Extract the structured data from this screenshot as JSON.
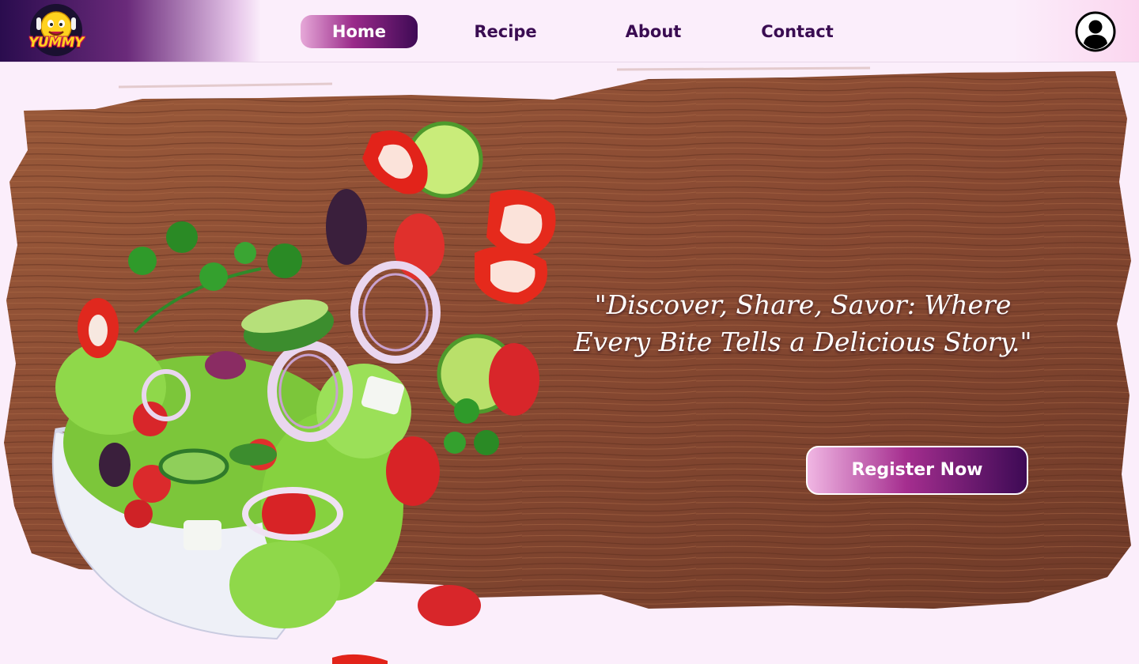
{
  "app": {
    "brand": "YUMMY",
    "logo_icon": "emoji-chef-logo-icon"
  },
  "nav": {
    "items": [
      {
        "label": "Home",
        "active": true
      },
      {
        "label": "Recipe",
        "active": false
      },
      {
        "label": "About",
        "active": false
      },
      {
        "label": "Contact",
        "active": false
      }
    ],
    "profile_icon": "user-avatar-icon"
  },
  "hero": {
    "quote_line1": "\"Discover, Share, Savor: Where",
    "quote_line2": "Every Bite Tells a Delicious Story.\"",
    "cta_label": "Register Now",
    "image": "salad-bowl-illustration"
  },
  "colors": {
    "brand_dark": "#3a0c52",
    "accent_pink": "#e6a8d8",
    "page_bg": "#fbeefb",
    "wood": "#8a4b33"
  }
}
